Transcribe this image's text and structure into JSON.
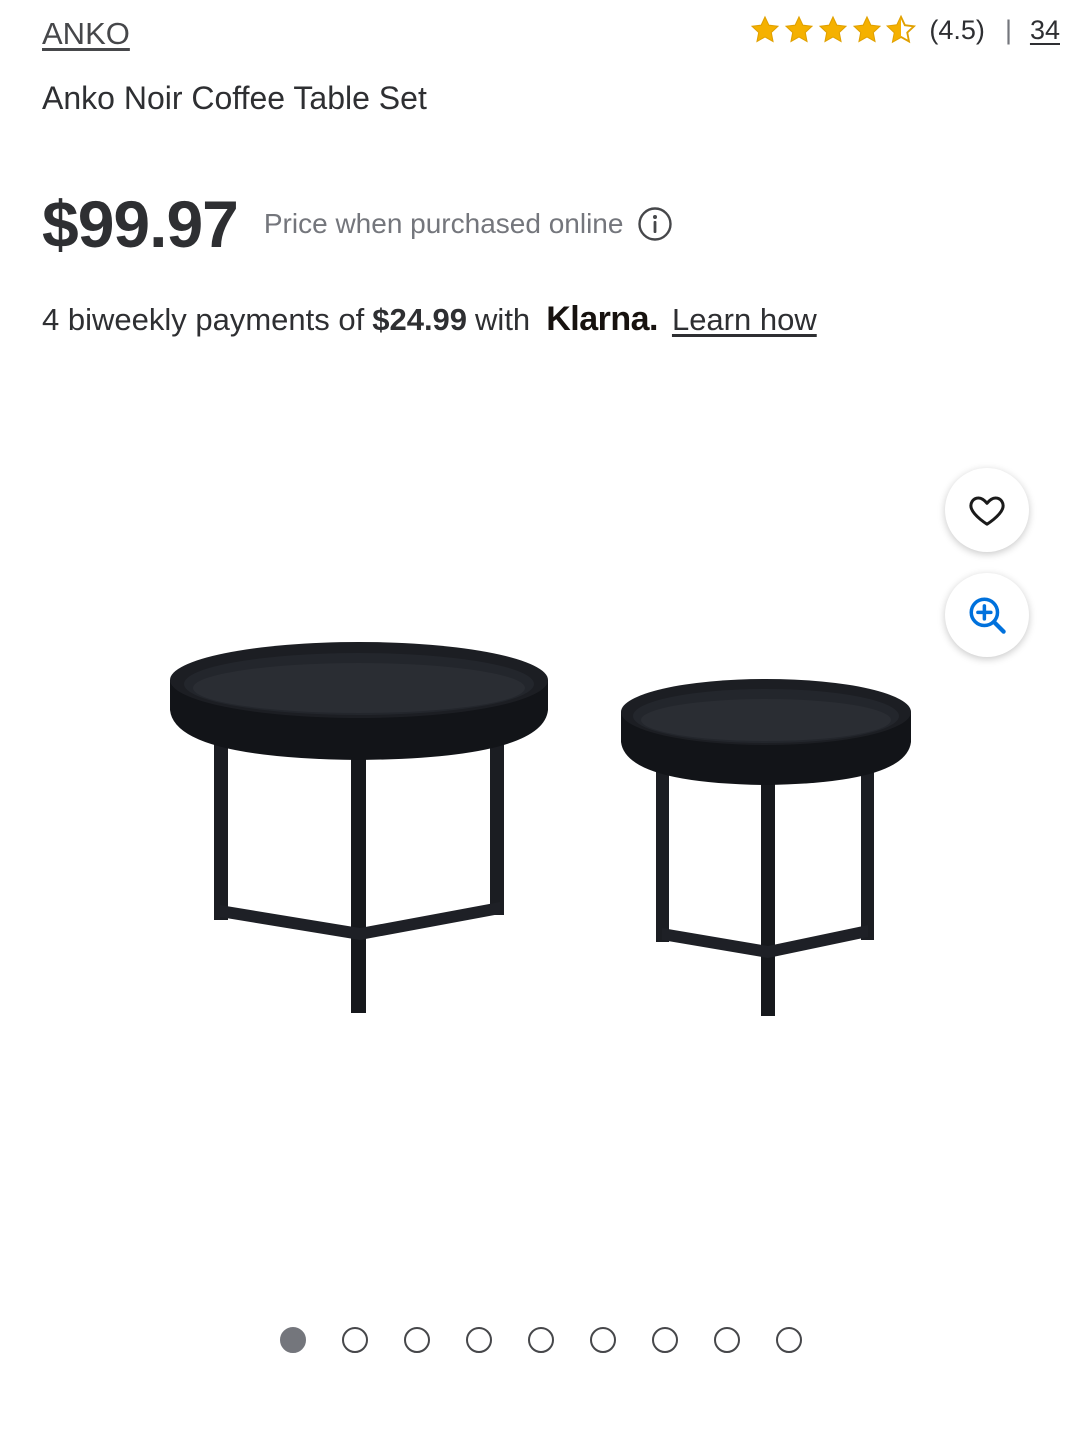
{
  "brand": {
    "label": "ANKO"
  },
  "rating": {
    "stars_value": 4.5,
    "value_text": "(4.5)",
    "separator": "|",
    "review_count": "34",
    "star_color": "#f5b100"
  },
  "product": {
    "title": "Anko Noir Coffee Table Set"
  },
  "price": {
    "amount": "$99.97",
    "note": "Price when purchased online",
    "info_icon": "info-icon"
  },
  "klarna": {
    "prefix": "4 biweekly payments of",
    "amount": "$24.99",
    "with_text": "with",
    "logo_text": "Klarna.",
    "link_label": "Learn how"
  },
  "gallery": {
    "favorite_icon": "heart-icon",
    "zoom_icon": "zoom-in-icon",
    "accent_color": "#0071dc",
    "image_count": 9,
    "active_index": 0
  }
}
